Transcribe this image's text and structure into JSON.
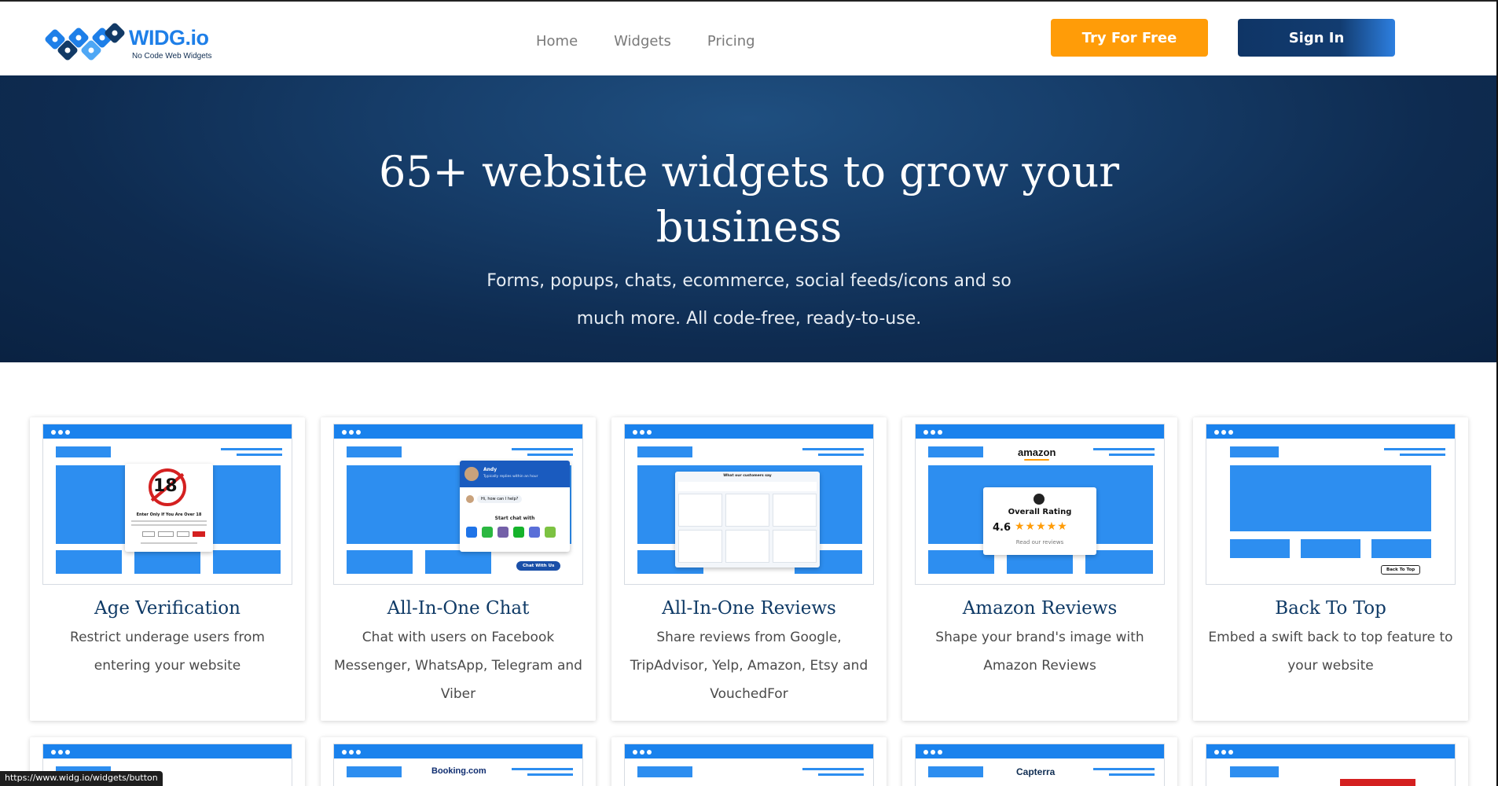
{
  "header": {
    "logo_text": "WIDG.io",
    "logo_tagline": "No Code Web Widgets",
    "nav": [
      "Home",
      "Widgets",
      "Pricing"
    ],
    "try_label": "Try For Free",
    "signin_label": "Sign In"
  },
  "hero": {
    "title": "65+ website widgets to grow your business",
    "subtitle": "Forms, popups, chats, ecommerce, social feeds/icons and so much more. All code-free, ready-to-use."
  },
  "cards": [
    {
      "title": "Age Verification",
      "desc": "Restrict underage users from entering your website"
    },
    {
      "title": "All-In-One Chat",
      "desc": "Chat with users on Facebook Messenger, WhatsApp, Telegram and Viber"
    },
    {
      "title": "All-In-One Reviews",
      "desc": "Share reviews from Google, TripAdvisor, Yelp, Amazon, Etsy and VouchedFor"
    },
    {
      "title": "Amazon Reviews",
      "desc": "Shape your brand's image with Amazon Reviews"
    },
    {
      "title": "Back To Top",
      "desc": "Embed a swift back to top feature to your website"
    }
  ],
  "thumb_text": {
    "age_badge": "18",
    "age_heading": "Enter Only If You Are Over 18",
    "chat_name": "Andy",
    "chat_status": "Typically replies within an hour",
    "chat_msg": "Hi, how can I help?",
    "chat_start": "Start chat with",
    "chat_btn": "Chat With Us",
    "reviews_heading": "What our customers say",
    "amazon_logo": "amazon",
    "amazon_rating_label": "Overall Rating",
    "amazon_rating": "4.6",
    "amazon_stars": "★★★★★",
    "amazon_read": "Read our reviews",
    "backtotop_btn": "Back To Top",
    "booking_logo": "Booking.com",
    "capterra_logo": "Capterra"
  },
  "status_url": "https://www.widg.io/widgets/button",
  "colors": {
    "brand_blue": "#1a82ed",
    "navy": "#0f3566",
    "orange": "#ff9c08"
  }
}
